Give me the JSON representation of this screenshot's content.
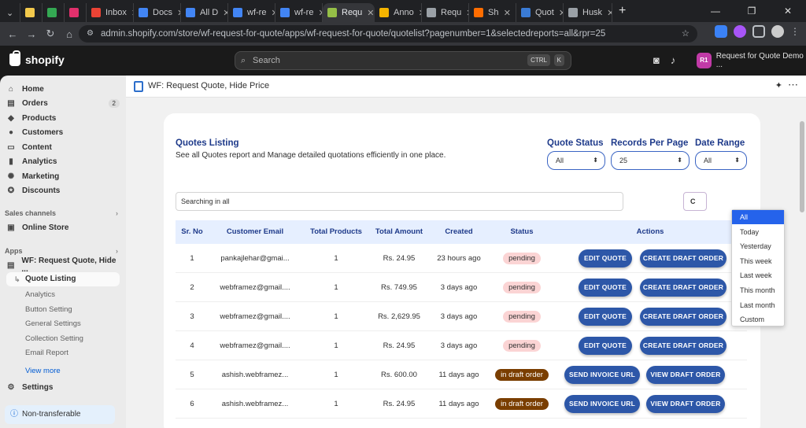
{
  "browser": {
    "tabs": [
      {
        "label": "",
        "color": "#f2c94c"
      },
      {
        "label": "",
        "color": "#34a853"
      },
      {
        "label": "",
        "color": "#e1306c"
      },
      {
        "label": "Inbox",
        "color": "#ea4335"
      },
      {
        "label": "Docs",
        "color": "#4285f4"
      },
      {
        "label": "All D",
        "color": "#4285f4"
      },
      {
        "label": "wf-re",
        "color": "#4285f4"
      },
      {
        "label": "wf-re",
        "color": "#4285f4"
      },
      {
        "label": "Requ",
        "color": "#95bf47"
      },
      {
        "label": "Anno",
        "color": "#f4b400"
      },
      {
        "label": "Requ",
        "color": "#9aa0a6"
      },
      {
        "label": "Sh",
        "color": "#ff6d00"
      },
      {
        "label": "Quot",
        "color": "#3a7bd5"
      },
      {
        "label": "Husk",
        "color": "#9aa0a6"
      }
    ],
    "url": "admin.shopify.com/store/wf-request-for-quote/apps/wf-request-for-quote/quotelist?pagenumber=1&selectedreports=all&rpr=25"
  },
  "topbar": {
    "brand": "shopify",
    "search_placeholder": "Search",
    "kbd1": "CTRL",
    "kbd2": "K",
    "store_initials": "R1",
    "store_name": "Request for Quote Demo ..."
  },
  "sidebar": {
    "items": [
      {
        "label": "Home",
        "icon": "⌂"
      },
      {
        "label": "Orders",
        "icon": "▤",
        "count": "2"
      },
      {
        "label": "Products",
        "icon": "◆"
      },
      {
        "label": "Customers",
        "icon": "●"
      },
      {
        "label": "Content",
        "icon": "▭"
      },
      {
        "label": "Analytics",
        "icon": "▮"
      },
      {
        "label": "Marketing",
        "icon": "✺"
      },
      {
        "label": "Discounts",
        "icon": "✪"
      }
    ],
    "sales_channels": "Sales channels",
    "online_store": "Online Store",
    "apps": "Apps",
    "app_name": "WF: Request Quote, Hide ...",
    "sub_items": [
      "Quote Listing",
      "Analytics",
      "Button Setting",
      "General Settings",
      "Collection Setting",
      "Email Report"
    ],
    "view_more": "View more",
    "settings": "Settings",
    "non_transferable": "Non-transferable"
  },
  "app": {
    "title": "WF: Request Quote, Hide Price",
    "listing_title": "Quotes Listing",
    "listing_sub": "See all Quotes report and Manage detailed quotations efficiently in one place.",
    "filters": {
      "status_label": "Quote Status",
      "status_value": "All",
      "records_label": "Records Per Page",
      "records_value": "25",
      "range_label": "Date Range",
      "range_value": "All"
    },
    "search_placeholder": "Searching in all",
    "c_button": "C",
    "range_options": [
      "All",
      "Today",
      "Yesterday",
      "This week",
      "Last week",
      "This month",
      "Last month",
      "Custom"
    ],
    "columns": [
      "Sr. No",
      "Customer Email",
      "Total Products",
      "Total Amount",
      "Created",
      "Status",
      "Actions"
    ],
    "rows": [
      {
        "sr": "1",
        "email": "pankajlehar@gmai...",
        "products": "1",
        "amount": "Rs. 24.95",
        "created": "23 hours ago",
        "status": "pending",
        "a1": "EDIT QUOTE",
        "a2": "CREATE DRAFT ORDER"
      },
      {
        "sr": "2",
        "email": "webframez@gmail....",
        "products": "1",
        "amount": "Rs. 749.95",
        "created": "3 days ago",
        "status": "pending",
        "a1": "EDIT QUOTE",
        "a2": "CREATE DRAFT ORDER"
      },
      {
        "sr": "3",
        "email": "webframez@gmail....",
        "products": "1",
        "amount": "Rs. 2,629.95",
        "created": "3 days ago",
        "status": "pending",
        "a1": "EDIT QUOTE",
        "a2": "CREATE DRAFT ORDER"
      },
      {
        "sr": "4",
        "email": "webframez@gmail....",
        "products": "1",
        "amount": "Rs. 24.95",
        "created": "3 days ago",
        "status": "pending",
        "a1": "EDIT QUOTE",
        "a2": "CREATE DRAFT ORDER"
      },
      {
        "sr": "5",
        "email": "ashish.webframez...",
        "products": "1",
        "amount": "Rs. 600.00",
        "created": "11 days ago",
        "status": "in draft order",
        "a1": "SEND INVOICE URL",
        "a2": "VIEW DRAFT ORDER"
      },
      {
        "sr": "6",
        "email": "ashish.webframez...",
        "products": "1",
        "amount": "Rs. 24.95",
        "created": "11 days ago",
        "status": "in draft order",
        "a1": "SEND INVOICE URL",
        "a2": "VIEW DRAFT ORDER"
      }
    ]
  }
}
